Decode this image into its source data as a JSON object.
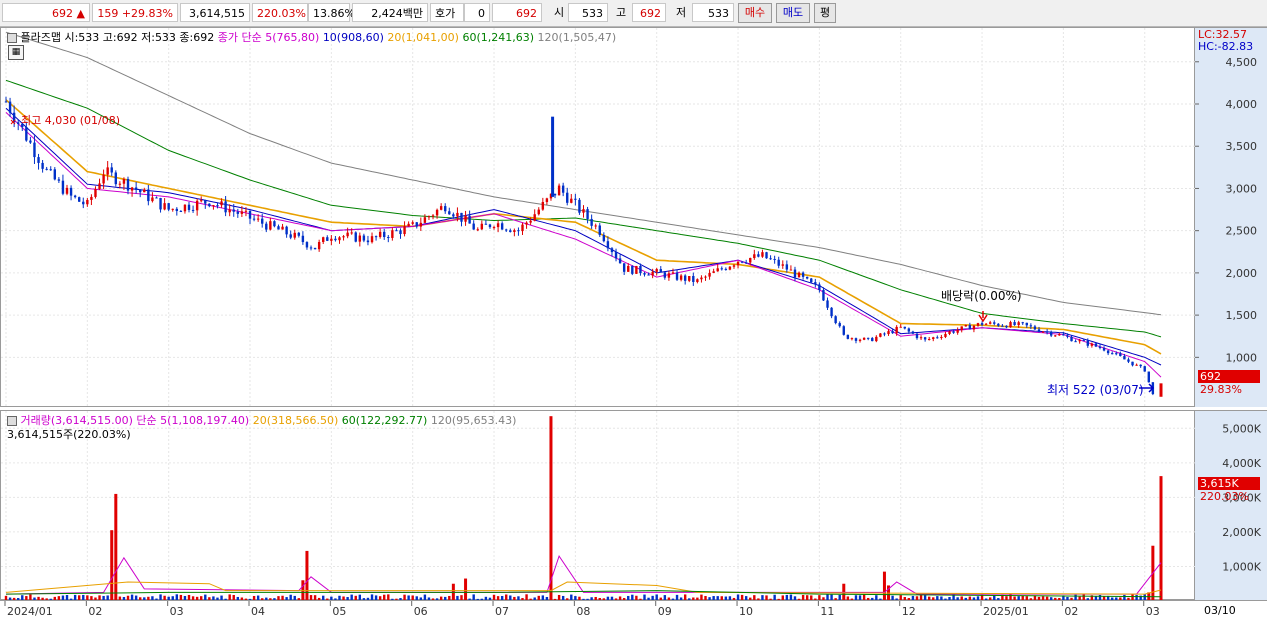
{
  "topbar": {
    "price": "692",
    "change": "159",
    "change_pct": "+29.83%",
    "volume": "3,614,515",
    "volume_ratio": "220.03%",
    "turnover": "13.86%",
    "amount": "2,424백만",
    "quote_label": "호가",
    "quote_value": "0",
    "quote_price": "692",
    "open_label": "시",
    "open": "533",
    "high_label": "고",
    "high": "692",
    "low_label": "저",
    "low": "533",
    "buy_label": "매수",
    "sell_label": "매도",
    "flat_label": "평"
  },
  "price_panel": {
    "stock_info": "플라즈맵 시:533 고:692 저:533 종:692",
    "ma_legend": [
      {
        "label": "종가 단순 5(765,80)",
        "color": "#cc00cc"
      },
      {
        "label": "10(908,60)",
        "color": "#0000c0"
      },
      {
        "label": "20(1,041,00)",
        "color": "#e8a000"
      },
      {
        "label": "60(1,241,63)",
        "color": "#008000"
      },
      {
        "label": "120(1,505,47)",
        "color": "#808080"
      }
    ],
    "lc": "LC:32.57",
    "hc": "HC:-82.83",
    "high_annotation": "최고 4,030 (01/08)",
    "low_annotation": "최저 522 (03/07)",
    "dividend_annotation": "배당락(0.00%)",
    "price_tag": "692",
    "price_tag_pct": "29.83%"
  },
  "volume_panel": {
    "legend": [
      {
        "label": "거래량(3,614,515.00)",
        "color": "#cc00cc"
      },
      {
        "label": "단순 5(1,108,197.40)",
        "color": "#cc00cc"
      },
      {
        "label": "20(318,566.50)",
        "color": "#e8a000"
      },
      {
        "label": "60(122,292.77)",
        "color": "#008000"
      },
      {
        "label": "120(95,653.43)",
        "color": "#808080"
      }
    ],
    "info": "3,614,515주(220.03%)",
    "vol_tag": "3,615K",
    "vol_tag_pct": "220.03%"
  },
  "x_axis_labels": [
    {
      "label": "2024/01",
      "month_index": 0
    },
    {
      "label": "02",
      "month_index": 1
    },
    {
      "label": "03",
      "month_index": 2
    },
    {
      "label": "04",
      "month_index": 3
    },
    {
      "label": "05",
      "month_index": 4
    },
    {
      "label": "06",
      "month_index": 5
    },
    {
      "label": "07",
      "month_index": 6
    },
    {
      "label": "08",
      "month_index": 7
    },
    {
      "label": "09",
      "month_index": 8
    },
    {
      "label": "10",
      "month_index": 9
    },
    {
      "label": "11",
      "month_index": 10
    },
    {
      "label": "12",
      "month_index": 11
    },
    {
      "label": "2025/01",
      "month_index": 12
    },
    {
      "label": "02",
      "month_index": 13
    },
    {
      "label": "03",
      "month_index": 14
    }
  ],
  "x_axis_date": "03/10",
  "chart_data": [
    {
      "type": "line",
      "ylim": [
        400,
        4900
      ],
      "yticks": [
        "1,000",
        "1,500",
        "2,000",
        "2,500",
        "3,000",
        "3,500",
        "4,000",
        "4,500"
      ],
      "ytick_values": [
        1000,
        1500,
        2000,
        2500,
        3000,
        3500,
        4000,
        4500
      ],
      "months": [
        "2024-01",
        "2024-02",
        "2024-03",
        "2024-04",
        "2024-05",
        "2024-06",
        "2024-07",
        "2024-08",
        "2024-09",
        "2024-10",
        "2024-11",
        "2024-12",
        "2025-01",
        "2025-02",
        "2025-03"
      ],
      "series": [
        {
          "name": "종가",
          "color": "#3030c0",
          "x": [
            0,
            0.5,
            0.8,
            1.0,
            1.2,
            1.5,
            2.0,
            2.5,
            3.0,
            3.5,
            3.8,
            4.0,
            4.5,
            5.0,
            5.4,
            5.8,
            6.0,
            6.3,
            6.6,
            6.8,
            7.0,
            7.3,
            7.6,
            8.0,
            8.5,
            9.0,
            9.3,
            9.6,
            10.0,
            10.3,
            10.6,
            11.0,
            11.3,
            11.6,
            12.0,
            12.5,
            13.0,
            13.5,
            14.0,
            14.1,
            14.2
          ],
          "values": [
            4030,
            3200,
            2900,
            2800,
            3200,
            3050,
            2750,
            2850,
            2650,
            2450,
            2300,
            2450,
            2400,
            2550,
            2800,
            2500,
            2600,
            2500,
            2800,
            3000,
            2800,
            2500,
            2050,
            2000,
            1900,
            2150,
            2200,
            2050,
            1800,
            1250,
            1200,
            1350,
            1200,
            1300,
            1400,
            1380,
            1250,
            1100,
            850,
            560,
            692
          ]
        },
        {
          "name": "5",
          "color": "#cc00cc",
          "x": [
            0,
            1,
            2,
            3,
            4,
            5,
            6,
            7,
            8,
            9,
            10,
            11,
            12,
            13,
            14,
            14.2
          ],
          "values": [
            3900,
            3000,
            2900,
            2700,
            2500,
            2550,
            2700,
            2400,
            1950,
            2150,
            1800,
            1250,
            1350,
            1270,
            950,
            766
          ]
        },
        {
          "name": "10",
          "color": "#0000c0",
          "x": [
            0,
            1,
            2,
            3,
            4,
            5,
            6,
            7,
            8,
            9,
            10,
            11,
            12,
            13,
            14,
            14.2
          ],
          "values": [
            3950,
            3050,
            2950,
            2750,
            2500,
            2550,
            2750,
            2500,
            2000,
            2150,
            1850,
            1280,
            1350,
            1290,
            1000,
            909
          ]
        },
        {
          "name": "20",
          "color": "#e8a000",
          "x": [
            0,
            1,
            2,
            3,
            4,
            5,
            6,
            7,
            8,
            9,
            10,
            11,
            12,
            13,
            14,
            14.2
          ],
          "values": [
            4050,
            3200,
            3000,
            2800,
            2600,
            2550,
            2700,
            2600,
            2150,
            2100,
            1950,
            1400,
            1380,
            1330,
            1150,
            1041
          ]
        },
        {
          "name": "60",
          "color": "#008000",
          "x": [
            0,
            1,
            2,
            3,
            4,
            5,
            6,
            7,
            8,
            9,
            10,
            11,
            12,
            13,
            14,
            14.2
          ],
          "values": [
            4280,
            3950,
            3450,
            3100,
            2800,
            2680,
            2620,
            2650,
            2500,
            2350,
            2150,
            1800,
            1520,
            1400,
            1300,
            1242
          ]
        },
        {
          "name": "120",
          "color": "#808080",
          "x": [
            0,
            1,
            2,
            3,
            4,
            5,
            6,
            7,
            8,
            9,
            10,
            11,
            12,
            13,
            14,
            14.2
          ],
          "values": [
            4850,
            4550,
            4100,
            3650,
            3300,
            3100,
            2900,
            2750,
            2600,
            2450,
            2300,
            2100,
            1850,
            1650,
            1530,
            1505
          ]
        }
      ]
    },
    {
      "type": "bar",
      "ylim": [
        0,
        5500
      ],
      "yticks": [
        "1,000K",
        "2,000K",
        "3,000K",
        "4,000K",
        "5,000K"
      ],
      "ytick_values": [
        1000,
        2000,
        3000,
        4000,
        5000
      ],
      "unit": "K",
      "spikes": [
        {
          "x": 1.3,
          "value": 2050
        },
        {
          "x": 1.35,
          "value": 3100
        },
        {
          "x": 3.7,
          "value": 1450
        },
        {
          "x": 3.65,
          "value": 600
        },
        {
          "x": 5.5,
          "value": 500
        },
        {
          "x": 5.65,
          "value": 650
        },
        {
          "x": 6.7,
          "value": 5350
        },
        {
          "x": 10.3,
          "value": 500
        },
        {
          "x": 10.8,
          "value": 850
        },
        {
          "x": 10.85,
          "value": 450
        },
        {
          "x": 14.05,
          "value": 250
        },
        {
          "x": 14.1,
          "value": 1600
        },
        {
          "x": 14.2,
          "value": 3615
        }
      ],
      "baseline_value": 150
    }
  ]
}
